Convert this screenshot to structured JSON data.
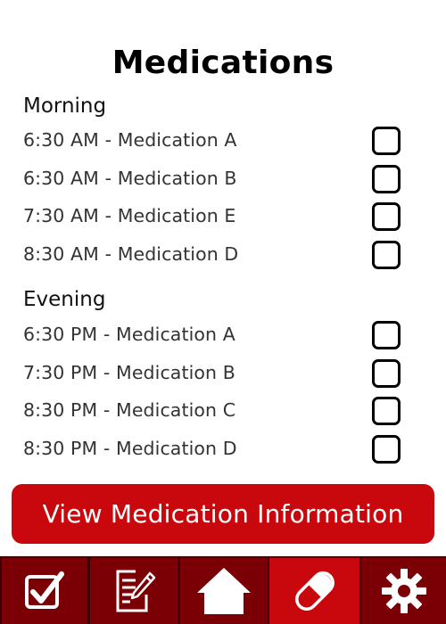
{
  "title": "Medications",
  "morning": {
    "heading": "Morning",
    "items": [
      {
        "label": "6:30 AM - Medication A",
        "checked": false
      },
      {
        "label": "6:30 AM - Medication B",
        "checked": false
      },
      {
        "label": "7:30 AM - Medication E",
        "checked": false
      },
      {
        "label": "8:30 AM - Medication D",
        "checked": false
      }
    ]
  },
  "evening": {
    "heading": "Evening",
    "items": [
      {
        "label": "6:30 PM - Medication A",
        "checked": false
      },
      {
        "label": "7:30 PM - Medication B",
        "checked": false
      },
      {
        "label": "8:30 PM - Medication C",
        "checked": false
      },
      {
        "label": "8:30 PM - Medication D",
        "checked": false
      }
    ]
  },
  "view_button_label": "View Medication Information",
  "nav": {
    "items": [
      {
        "icon": "checklist-icon"
      },
      {
        "icon": "notes-icon"
      },
      {
        "icon": "home-icon"
      },
      {
        "icon": "pill-icon",
        "active": true
      },
      {
        "icon": "gear-icon"
      }
    ]
  },
  "colors": {
    "accent": "#c8080d",
    "nav_dark": "#7a0005",
    "nav_border": "#3d0003"
  }
}
